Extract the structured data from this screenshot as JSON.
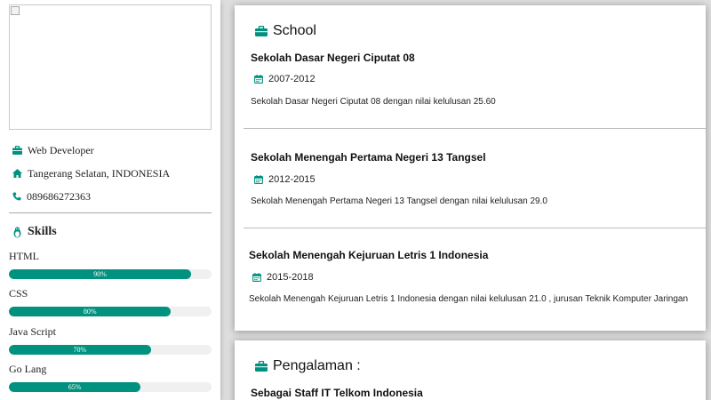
{
  "profile": {
    "job": "Web Developer",
    "location": "Tangerang Selatan, INDONESIA",
    "phone": "089686272363"
  },
  "skills": {
    "title": "Skills",
    "items": [
      {
        "name": "HTML",
        "percent": 90,
        "label": "90%"
      },
      {
        "name": "CSS",
        "percent": 80,
        "label": "80%"
      },
      {
        "name": "Java Script",
        "percent": 70,
        "label": "70%"
      },
      {
        "name": "Go Lang",
        "percent": 65,
        "label": "65%"
      }
    ]
  },
  "school": {
    "title": "School",
    "entries": [
      {
        "name": "Sekolah Dasar Negeri Ciputat 08",
        "years": "2007-2012",
        "desc": "Sekolah Dasar Negeri Ciputat 08 dengan nilai kelulusan 25.60"
      },
      {
        "name": "Sekolah Menengah Pertama Negeri 13 Tangsel",
        "years": "2012-2015",
        "desc": "Sekolah Menengah Pertama Negeri 13 Tangsel dengan nilai kelulusan 29.0"
      },
      {
        "name": "Sekolah Menengah Kejuruan Letris 1 Indonesia",
        "years": "2015-2018",
        "desc": "Sekolah Menengah Kejuruan Letris 1 Indonesia dengan nilai kelulusan 21.0 , jurusan Teknik Komputer Jaringan"
      }
    ]
  },
  "experience": {
    "title": "Pengalaman :",
    "first_entry": "Sebagai Staff IT Telkom Indonesia"
  },
  "colors": {
    "accent": "#00927e",
    "track": "#f0f0f0"
  }
}
